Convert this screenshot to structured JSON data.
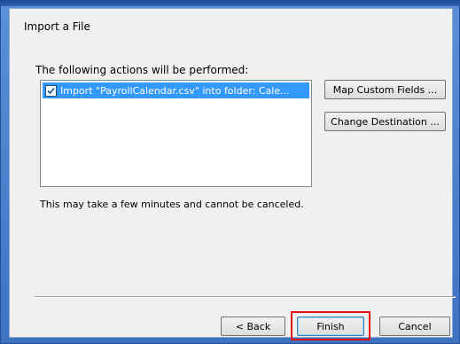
{
  "dialog": {
    "title": "Import a File",
    "actions_label": "The following actions will be performed:",
    "actions": [
      {
        "label": "Import \"PayrollCalendar.csv\" into folder: Cale...",
        "checked": true
      }
    ],
    "map_fields_label": "Map Custom Fields ...",
    "change_destination_label": "Change Destination ...",
    "warning_text": "This may take a few minutes and cannot be canceled."
  },
  "footer": {
    "back_label": "< Back",
    "finish_label": "Finish",
    "cancel_label": "Cancel"
  },
  "colors": {
    "frame_blue": "#3e73c2",
    "selection_blue": "#3399ff",
    "highlight_red": "#e01212",
    "dialog_bg": "#f0f0f0"
  },
  "icons": {
    "checkbox": "checkmark-icon"
  }
}
